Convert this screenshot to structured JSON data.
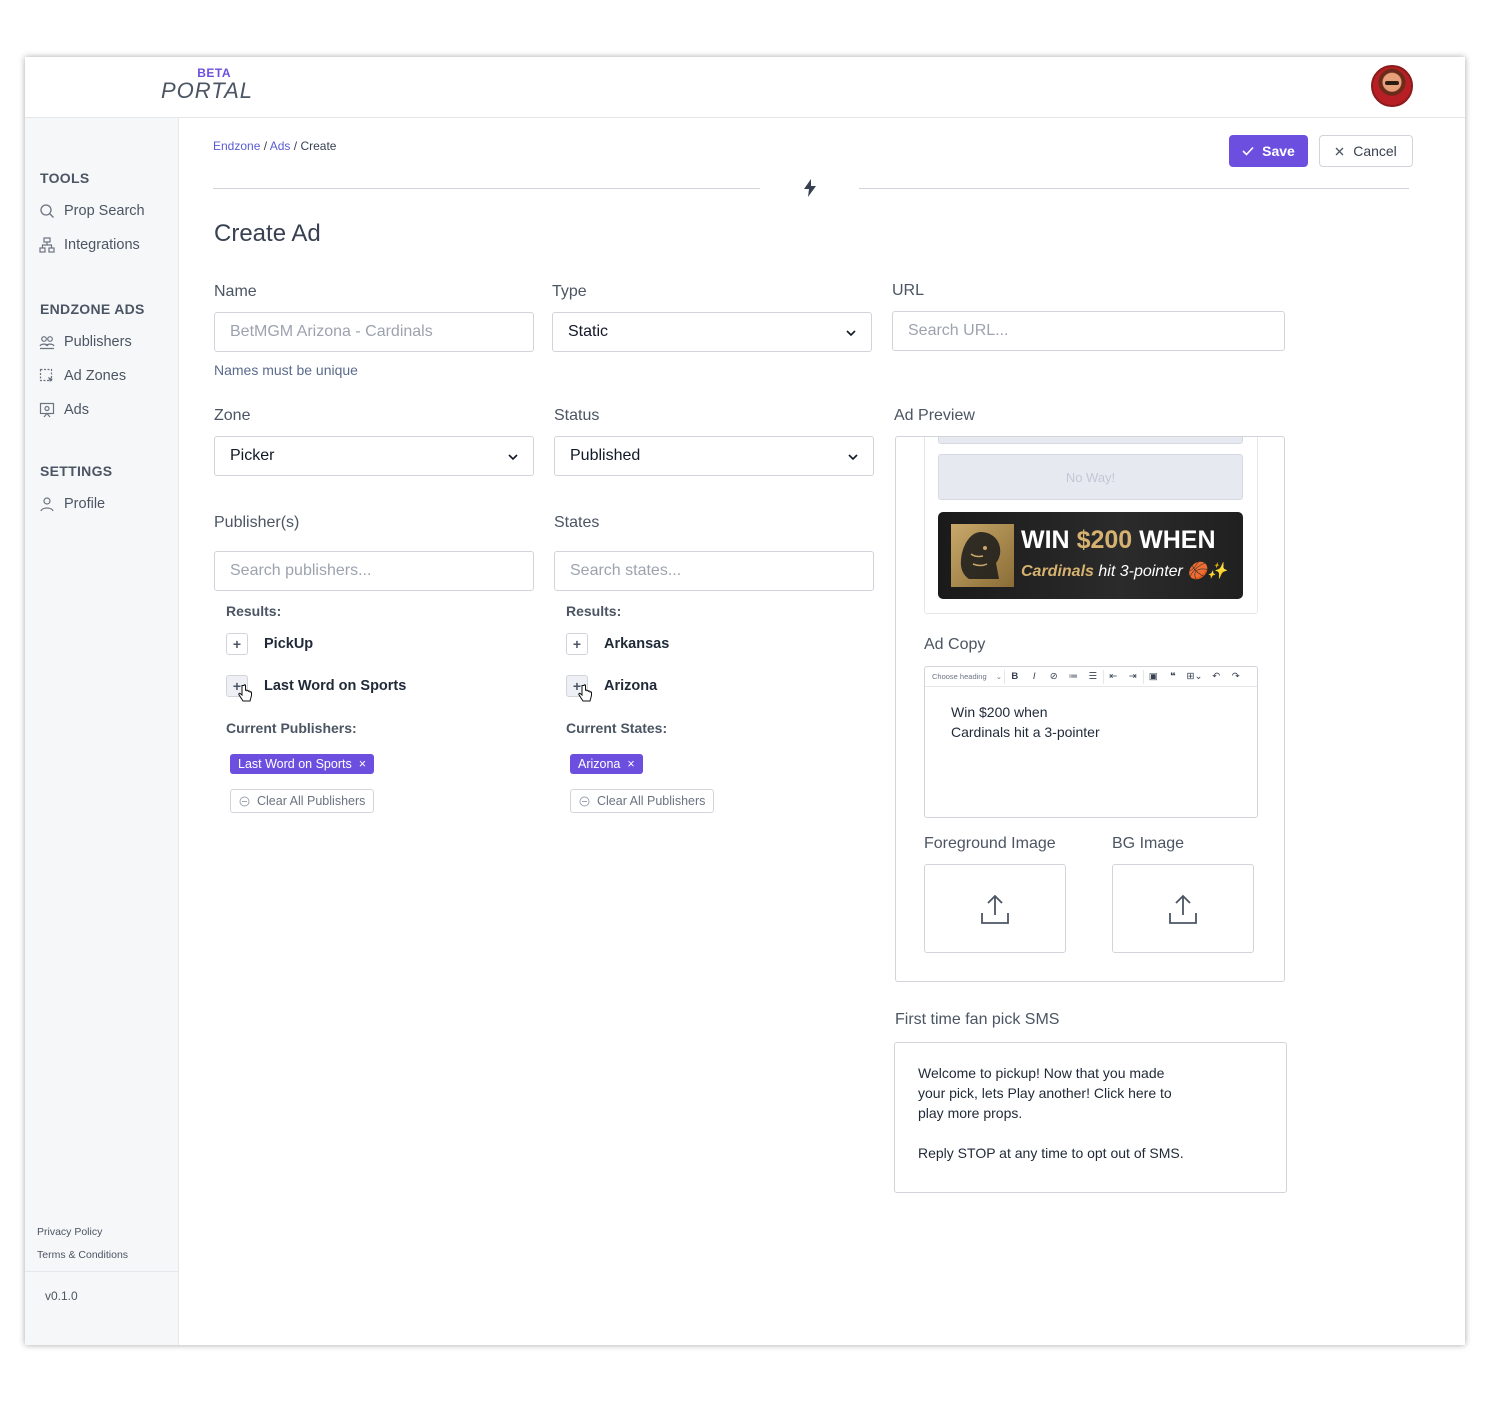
{
  "brand": {
    "beta": "BETA",
    "portal": "PORTAL"
  },
  "sidebar": {
    "tools_heading": "TOOLS",
    "tools": [
      {
        "label": "Prop Search",
        "icon": "search-icon"
      },
      {
        "label": "Integrations",
        "icon": "network-icon"
      }
    ],
    "ads_heading": "ENDZONE ADS",
    "ads": [
      {
        "label": "Publishers",
        "icon": "users-icon"
      },
      {
        "label": "Ad Zones",
        "icon": "zone-select-icon"
      },
      {
        "label": "Ads",
        "icon": "ad-icon"
      }
    ],
    "settings_heading": "SETTINGS",
    "settings": [
      {
        "label": "Profile",
        "icon": "user-icon"
      }
    ],
    "footer": {
      "privacy": "Privacy Policy",
      "terms": "Terms & Conditions",
      "version": "v0.1.0"
    }
  },
  "breadcrumb": {
    "root": "Endzone",
    "sep1": "/",
    "section": "Ads",
    "sep2": "/",
    "current": "Create"
  },
  "actions": {
    "save": "Save",
    "cancel": "Cancel"
  },
  "page_title": "Create Ad",
  "form": {
    "name": {
      "label": "Name",
      "placeholder": "BetMGM Arizona - Cardinals",
      "hint": "Names must be unique"
    },
    "type": {
      "label": "Type",
      "value": "Static"
    },
    "url": {
      "label": "URL",
      "placeholder": "Search URL..."
    },
    "zone": {
      "label": "Zone",
      "value": "Picker"
    },
    "status": {
      "label": "Status",
      "value": "Published"
    },
    "publishers": {
      "label": "Publisher(s)",
      "placeholder": "Search publishers...",
      "results_heading": "Results:",
      "results": [
        "PickUp",
        "Last Word on Sports"
      ],
      "current_heading": "Current Publishers:",
      "current": [
        "Last Word on Sports"
      ],
      "clear_label": "Clear All Publishers"
    },
    "states": {
      "label": "States",
      "placeholder": "Search states...",
      "results_heading": "Results:",
      "results": [
        "Arkansas",
        "Arizona"
      ],
      "current_heading": "Current States:",
      "current": [
        "Arizona"
      ],
      "clear_label": "Clear All Publishers"
    }
  },
  "preview": {
    "label": "Ad Preview",
    "no_way": "No Way!",
    "banner": {
      "win": "WIN",
      "amount": "$200",
      "when": "WHEN",
      "team": "Cardinals",
      "rest": "hit 3-pointer",
      "emoji": "🏀✨"
    },
    "ad_copy_label": "Ad Copy",
    "editor_heading_select": "Choose heading",
    "ad_copy_lines": [
      "Win $200 when",
      "Cardinals hit a 3-pointer"
    ],
    "foreground_label": "Foreground Image",
    "bg_label": "BG Image"
  },
  "sms": {
    "label": "First time fan pick SMS",
    "lines": [
      "Welcome to pickup! Now that you made",
      "your pick, lets Play another! Click here to",
      "play more props."
    ],
    "footer_line": "Reply STOP at any time to opt out of SMS."
  },
  "colors": {
    "accent": "#6d4fe0",
    "link": "#5b5bd6",
    "gold": "#d6b270"
  }
}
